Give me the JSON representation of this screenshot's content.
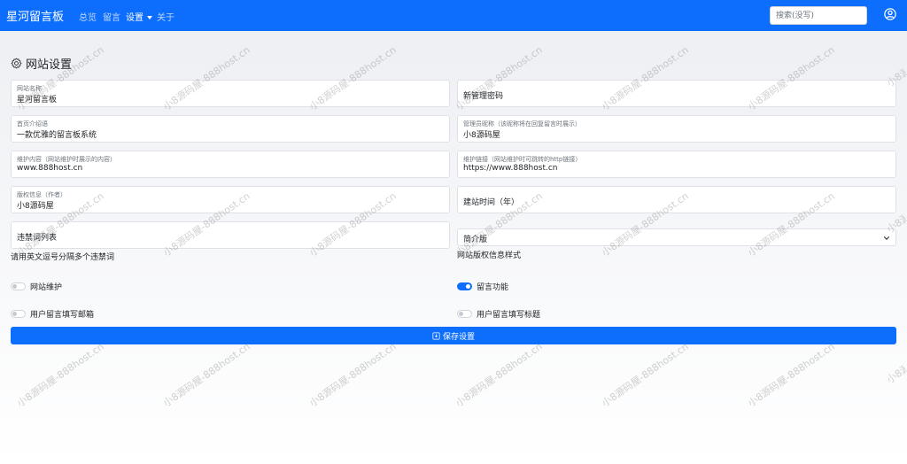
{
  "navbar": {
    "brand": "星河留言板",
    "links": [
      {
        "label": "总览"
      },
      {
        "label": "留言"
      },
      {
        "label": "设置"
      },
      {
        "label": "关于"
      }
    ],
    "search_placeholder": "搜索(没写)"
  },
  "page": {
    "title": "网站设置"
  },
  "form": {
    "site_name": {
      "label": "网站名称",
      "value": "星河留言板"
    },
    "new_password": {
      "placeholder": "新管理密码"
    },
    "intro": {
      "label": "首页介绍语",
      "value": "一款优雅的留言板系统"
    },
    "admin_nickname": {
      "label": "管理员昵称（该昵称将在回复留言时展示）",
      "value": "小8源码屋"
    },
    "maintenance_content": {
      "label": "维护内容（网站维护时展示的内容）",
      "value": "www.888host.cn"
    },
    "maintenance_link": {
      "label": "维护链接（网站维护时可跳转的http链接）",
      "value": "https://www.888host.cn"
    },
    "copyright": {
      "label": "版权信息（作者）",
      "value": "小8源码屋"
    },
    "build_year": {
      "placeholder": "建站时间（年）"
    },
    "banned_words": {
      "placeholder": "违禁词列表",
      "help": "请用英文逗号分隔多个违禁词"
    },
    "copyright_style": {
      "value": "简介版",
      "help": "网站版权信息样式"
    }
  },
  "switches": {
    "maintenance": {
      "label": "网站维护",
      "on": false
    },
    "message": {
      "label": "留言功能",
      "on": true
    },
    "require_email": {
      "label": "用户留言填写邮箱",
      "on": false
    },
    "require_title": {
      "label": "用户留言填写标题",
      "on": false
    }
  },
  "actions": {
    "save_label": "保存设置"
  },
  "watermark": "小8源码屋-888host.cn",
  "colors": {
    "primary": "#0d6efd"
  }
}
